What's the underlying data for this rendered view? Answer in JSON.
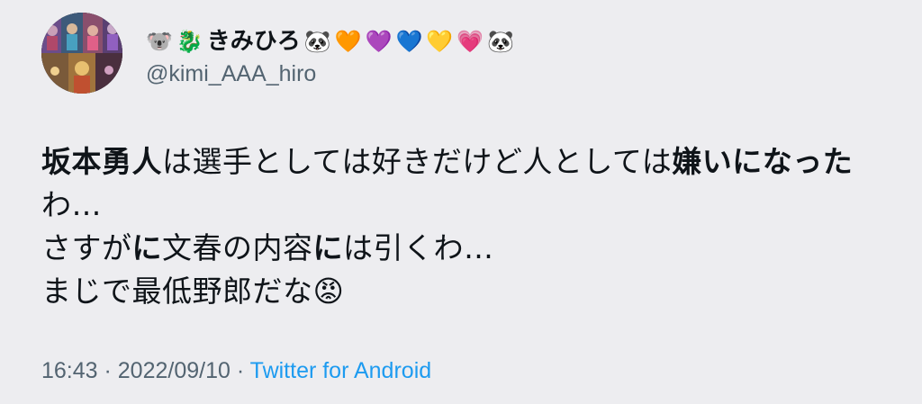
{
  "tweet": {
    "display_name": {
      "emoji_prefix": [
        "🐨",
        "🐉"
      ],
      "name": "きみひろ",
      "emoji_suffix": [
        "🐼",
        "🧡",
        "💜",
        "💙",
        "💛",
        "💗",
        "🐼"
      ]
    },
    "handle": "@kimi_AAA_hiro",
    "body": {
      "line1": [
        {
          "text": "坂本勇人",
          "bold": true
        },
        {
          "text": "は選手としては好きだけど人としては",
          "bold": false
        },
        {
          "text": "嫌いになった",
          "bold": true
        }
      ],
      "line2": [
        {
          "text": "わ…",
          "bold": false
        }
      ],
      "line3": [
        {
          "text": "さすが",
          "bold": false
        },
        {
          "text": "に",
          "bold": true
        },
        {
          "text": "文春の内容",
          "bold": false
        },
        {
          "text": "に",
          "bold": true
        },
        {
          "text": "は引くわ…",
          "bold": false
        }
      ],
      "line4": [
        {
          "text": "まじで最低野郎だな😡",
          "bold": false
        }
      ]
    },
    "time": "16:43",
    "separator": " · ",
    "date": "2022/09/10",
    "source": "Twitter for Android"
  },
  "colors": {
    "background": "#ededf0",
    "text": "#0f1419",
    "secondary_text": "#536471",
    "link": "#1d9bf0"
  }
}
